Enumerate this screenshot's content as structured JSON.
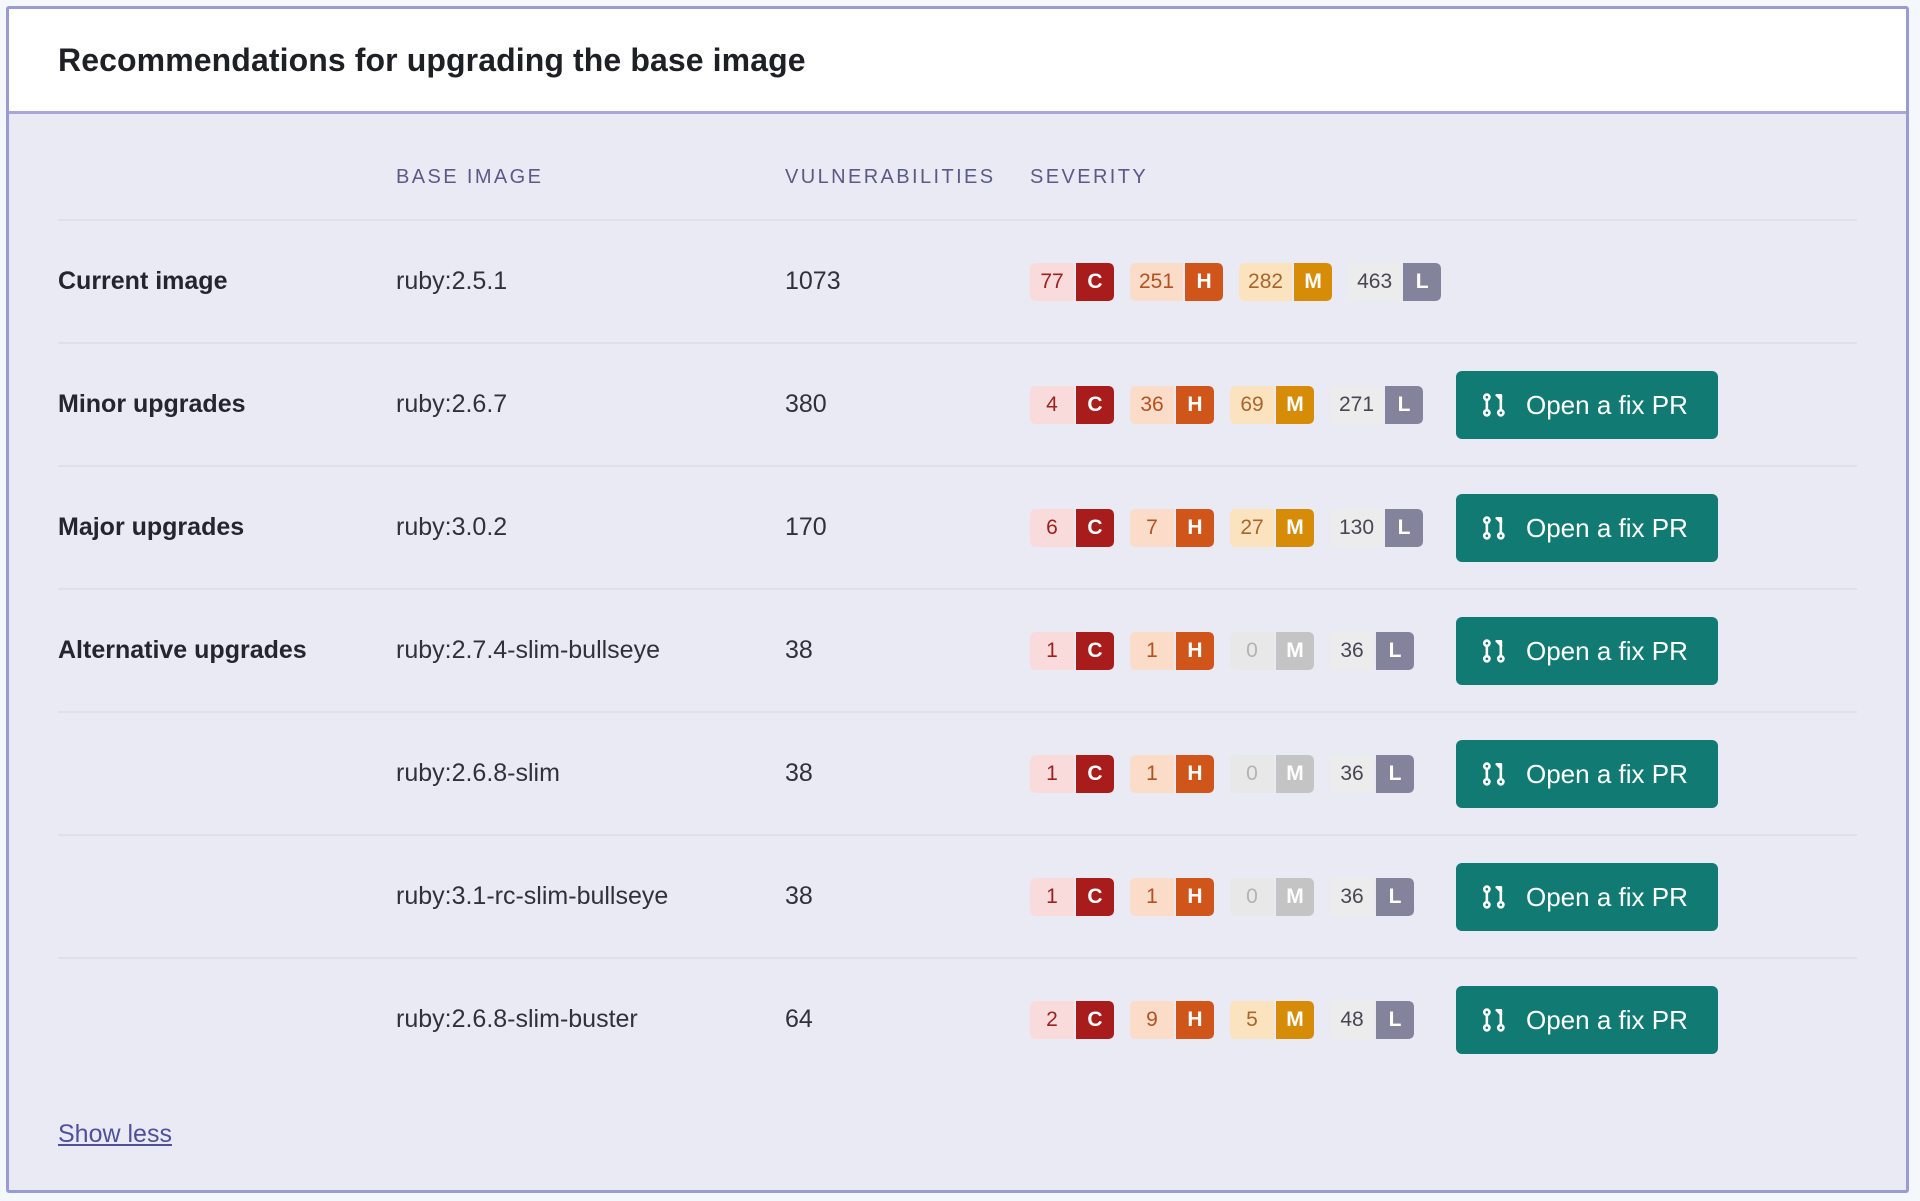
{
  "panel": {
    "title": "Recommendations for upgrading the base image",
    "border_color": "#9a9ad4",
    "background_color": "#eaeaf5"
  },
  "table": {
    "columns": {
      "category": "",
      "base_image": "BASE IMAGE",
      "vulnerabilities": "VULNERABILITIES",
      "severity": "SEVERITY",
      "action": ""
    },
    "rows": [
      {
        "category": "Current image",
        "base_image": "ruby:2.5.1",
        "vulnerabilities": "1073",
        "severity": {
          "critical": "77",
          "high": "251",
          "medium": "282",
          "low": "463"
        },
        "action": null
      },
      {
        "category": "Minor upgrades",
        "base_image": "ruby:2.6.7",
        "vulnerabilities": "380",
        "severity": {
          "critical": "4",
          "high": "36",
          "medium": "69",
          "low": "271"
        },
        "action": "Open a fix PR"
      },
      {
        "category": "Major upgrades",
        "base_image": "ruby:3.0.2",
        "vulnerabilities": "170",
        "severity": {
          "critical": "6",
          "high": "7",
          "medium": "27",
          "low": "130"
        },
        "action": "Open a fix PR"
      },
      {
        "category": "Alternative upgrades",
        "base_image": "ruby:2.7.4-slim-bullseye",
        "vulnerabilities": "38",
        "severity": {
          "critical": "1",
          "high": "1",
          "medium": "0",
          "low": "36"
        },
        "action": "Open a fix PR"
      },
      {
        "category": "",
        "base_image": "ruby:2.6.8-slim",
        "vulnerabilities": "38",
        "severity": {
          "critical": "1",
          "high": "1",
          "medium": "0",
          "low": "36"
        },
        "action": "Open a fix PR"
      },
      {
        "category": "",
        "base_image": "ruby:3.1-rc-slim-bullseye",
        "vulnerabilities": "38",
        "severity": {
          "critical": "1",
          "high": "1",
          "medium": "0",
          "low": "36"
        },
        "action": "Open a fix PR"
      },
      {
        "category": "",
        "base_image": "ruby:2.6.8-slim-buster",
        "vulnerabilities": "64",
        "severity": {
          "critical": "2",
          "high": "9",
          "medium": "5",
          "low": "48"
        },
        "action": "Open a fix PR"
      }
    ]
  },
  "severity_letters": {
    "critical": "C",
    "high": "H",
    "medium": "M",
    "low": "L"
  },
  "severity_colors": {
    "critical": "#a81c1c",
    "high": "#d0551b",
    "medium": "#d68c06",
    "low": "#83839c",
    "zero": "#c4c4c4"
  },
  "action_button": {
    "label": "Open a fix PR",
    "icon": "pull-request-icon",
    "color": "#117a72"
  },
  "footer": {
    "show_less": "Show less"
  }
}
